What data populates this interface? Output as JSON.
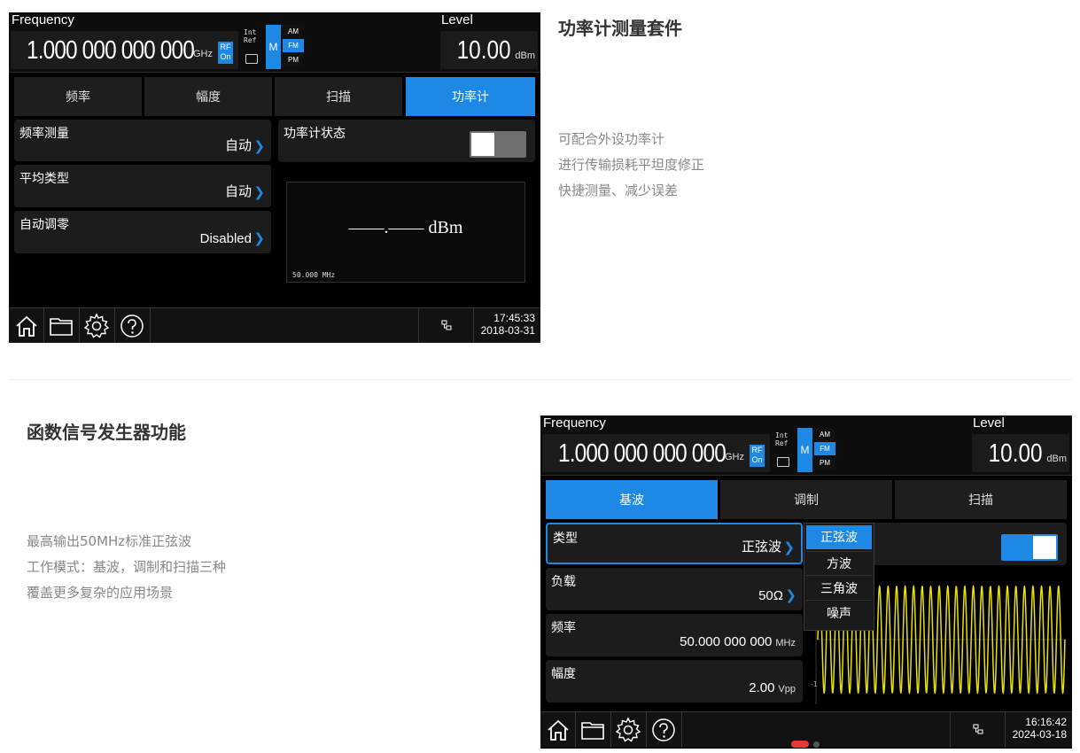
{
  "top_section": {
    "heading": "功率计测量套件",
    "desc": [
      "可配合外设功率计",
      "进行传输损耗平坦度修正",
      "快捷测量、减少误差"
    ]
  },
  "bottom_section": {
    "heading": "函数信号发生器功能",
    "desc": [
      "最高输出50MHz标准正弦波",
      "工作模式：基波，调制和扫描三种",
      "覆盖更多复杂的应用场景"
    ]
  },
  "screen1": {
    "frequency_label": "Frequency",
    "frequency_value": "1.000 000 000 000",
    "frequency_unit": "GHz",
    "rf_label": "RF",
    "rf_state": "On",
    "int_label": "Int",
    "ref_label": "Ref",
    "m_label": "M",
    "mods": [
      "AM",
      "FM",
      "PM"
    ],
    "level_label": "Level",
    "level_value": "10.00",
    "level_unit": "dBm",
    "tabs": [
      "频率",
      "幅度",
      "扫描",
      "功率计"
    ],
    "active_tab": 3,
    "params": [
      {
        "name": "频率测量",
        "value": "自动"
      },
      {
        "name": "平均类型",
        "value": "自动"
      },
      {
        "name": "自动调零",
        "value": "Disabled"
      }
    ],
    "power_state_label": "功率计状态",
    "power_state_on": false,
    "reading": "——.—— dBm",
    "reading_freq": "50.000 MHz",
    "time": "17:45:33",
    "date": "2018-03-31"
  },
  "screen2": {
    "frequency_label": "Frequency",
    "frequency_value": "1.000 000 000 000",
    "frequency_unit": "GHz",
    "rf_label": "RF",
    "rf_state": "On",
    "int_label": "Int",
    "ref_label": "Ref",
    "m_label": "M",
    "mods": [
      "AM",
      "FM",
      "PM"
    ],
    "level_label": "Level",
    "level_value": "10.00",
    "level_unit": "dBm",
    "tabs": [
      "基波",
      "调制",
      "扫描"
    ],
    "active_tab": 0,
    "params": [
      {
        "name": "类型",
        "value": "正弦波",
        "unit": ""
      },
      {
        "name": "负载",
        "value": "50Ω",
        "unit": ""
      },
      {
        "name": "频率",
        "value": "50.000 000 000",
        "unit": "MHz"
      },
      {
        "name": "幅度",
        "value": "2.00",
        "unit": "Vpp"
      }
    ],
    "dropdown_options": [
      "正弦波",
      "方波",
      "三角波",
      "噪声"
    ],
    "dropdown_selected": 0,
    "output_on": true,
    "axis_label_neg": "-1",
    "time": "16:16:42",
    "date": "2024-03-18"
  },
  "colors": {
    "accent": "#1e88e5",
    "waveform": "#e8e000",
    "heading": "#333333",
    "desc": "#888888"
  }
}
